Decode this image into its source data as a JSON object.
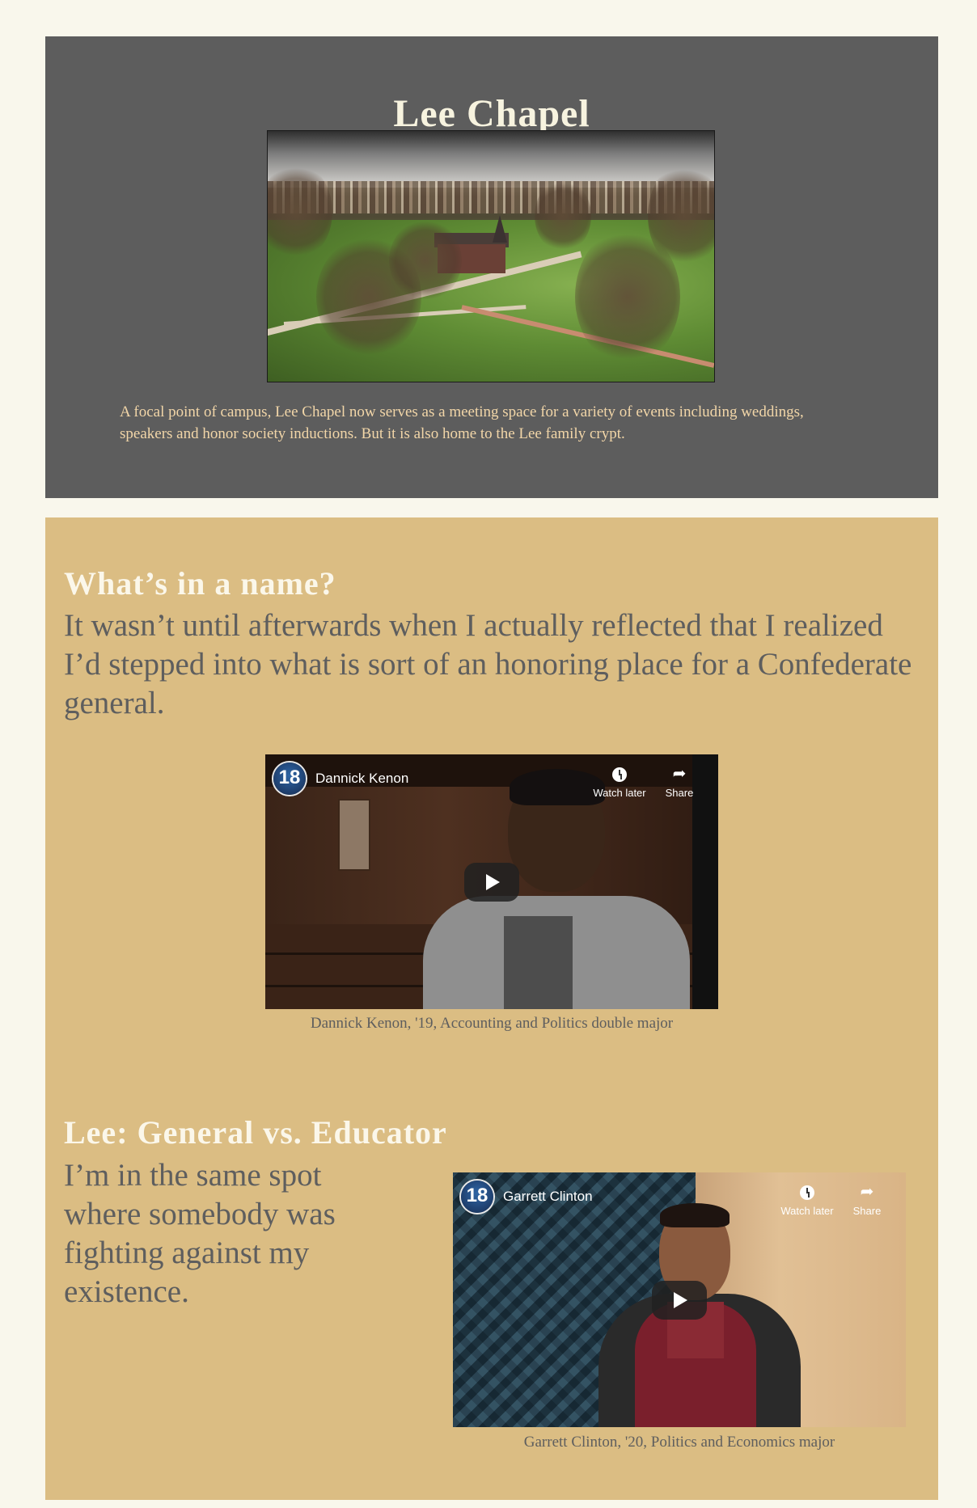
{
  "section1": {
    "title": "Lee Chapel",
    "description": "A focal point of campus, Lee Chapel now serves as a meeting space for a variety of events including weddings, speakers and honor society inductions. But it is also home to the Lee family crypt."
  },
  "section2": {
    "heading": "What’s in a name?",
    "quote": "It wasn’t until afterwards when I actually reflected that I realized I’d stepped into what is sort of an honoring place for a Confederate general.",
    "video": {
      "channel_badge": "18",
      "title": "Dannick Kenon",
      "watch_later_label": "Watch later",
      "share_label": "Share"
    },
    "caption": "Dannick Kenon, '19, Accounting and Politics double major"
  },
  "section3": {
    "heading": "Lee: General vs. Educator",
    "quote": "I’m in the same spot where somebody was fighting against my existence.",
    "video": {
      "channel_badge": "18",
      "title": "Garrett Clinton",
      "watch_later_label": "Watch later",
      "share_label": "Share"
    },
    "caption": "Garrett Clinton, '20, Politics and Economics major"
  },
  "icons": {
    "watch_later": "clock-icon",
    "share": "share-arrow-icon",
    "play": "play-icon",
    "channel": "channel-logo"
  }
}
